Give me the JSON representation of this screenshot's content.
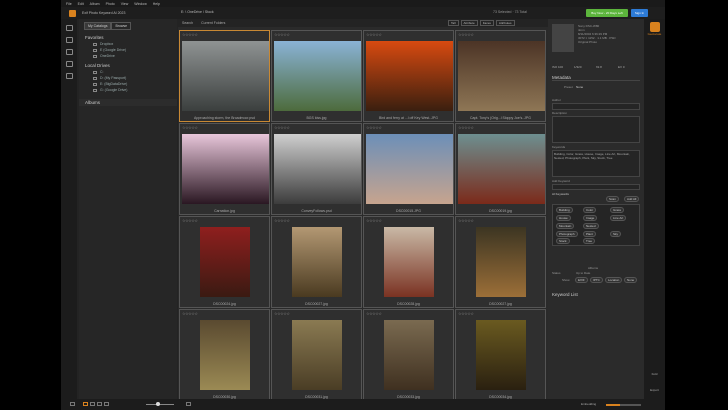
{
  "menu": [
    "File",
    "Edit",
    "Album",
    "Photo",
    "View",
    "Window",
    "Help"
  ],
  "window": {
    "title": "Exif Photo Keyword AI 2023"
  },
  "breadcrumb": "E: \\ OneDrive \\ Stock",
  "selection": "73 Selected · 73 Total",
  "buy_label": "Buy Now - 20 Days Left",
  "signin_label": "Sign In",
  "geolocate": "Geolocate",
  "nav": {
    "tabs": [
      "My Catalogs",
      "Browse"
    ],
    "favorites_head": "Favorites",
    "favorites": [
      "Dropbox",
      "E (Google Drive)",
      "OneDrive"
    ],
    "local_head": "Local Drives",
    "local": [
      "C:",
      "D: (My Passport)",
      "E: (BigDataDrive)",
      "G: (Google Drive)"
    ],
    "albums_head": "Albums"
  },
  "grid": {
    "search_label": "Search",
    "folder_label": "Current Folders",
    "filters": [
      "Tall",
      "Attribute",
      "Faces",
      "Attributes"
    ],
    "sort_label": "Name",
    "rating": "☆☆☆☆☆",
    "items": [
      {
        "name": "Approaching storm, the Broadmoor.psd",
        "selected": true,
        "colors": [
          "#8f9393",
          "#3b3f3e"
        ]
      },
      {
        "name": "BGS kiss.jpg",
        "selected": false,
        "colors": [
          "#8ab3d6",
          "#4d6b3c"
        ]
      },
      {
        "name": "Bird and ferry at ...l off Key West..JPG",
        "selected": false,
        "colors": [
          "#d84a10",
          "#3a1f0f"
        ]
      },
      {
        "name": "Capt. Tony's (Orig...l Sloppy Joe's..JPG",
        "selected": false,
        "colors": [
          "#4c3426",
          "#8e7655"
        ]
      },
      {
        "name": "Carnation.jpg",
        "selected": false,
        "colors": [
          "#e8c6da",
          "#2a1722"
        ]
      },
      {
        "name": "ConveyFollows.psd",
        "selected": false,
        "colors": [
          "#cfcfcf",
          "#3c3c3c"
        ]
      },
      {
        "name": "DSC00015.JPG",
        "selected": false,
        "colors": [
          "#6c8fb8",
          "#c7a48e"
        ]
      },
      {
        "name": "DSC00019.jpg",
        "selected": false,
        "colors": [
          "#6d8f90",
          "#7b2a1a"
        ]
      },
      {
        "name": "DSC00024.jpg",
        "selected": false,
        "colors": [
          "#8f1f1e",
          "#3a1a12"
        ]
      },
      {
        "name": "DSC00027.jpg",
        "selected": false,
        "colors": [
          "#b39873",
          "#4a3a20"
        ]
      },
      {
        "name": "DSC00028.jpg",
        "selected": false,
        "colors": [
          "#c9b9a6",
          "#7a3222"
        ]
      },
      {
        "name": "DSC00027.jpg",
        "selected": false,
        "colors": [
          "#3c3522",
          "#9c6f38"
        ]
      },
      {
        "name": "DSC00030.jpg",
        "selected": false,
        "colors": [
          "#5a4a30",
          "#9b8a54"
        ]
      },
      {
        "name": "DSC00031.jpg",
        "selected": false,
        "colors": [
          "#8a7a52",
          "#4a3d25"
        ]
      },
      {
        "name": "DSC00033.jpg",
        "selected": false,
        "colors": [
          "#7a6a50",
          "#3f3020"
        ]
      },
      {
        "name": "DSC00034.jpg",
        "selected": false,
        "colors": [
          "#6a5a20",
          "#2a2010"
        ]
      }
    ]
  },
  "info": {
    "line1": "Sony DSC-W80",
    "line2": "4mm",
    "line3": "8/11/2002 6:36:29 PM",
    "line4": "3072 × 1152 · 1.1 MB · PSD",
    "line5": "Original Photo",
    "exif": [
      "ISO 100",
      "1/320",
      "f/2.8",
      "EV 0"
    ],
    "metadata_head": "Metadata",
    "preset_label": "Preset",
    "preset_value": "None",
    "author_label": "Author",
    "description_label": "Description",
    "keywords_label": "Keywords",
    "keywords_text": "Building, Color, Grass, House, Image, Line Art, Mountain, Nested, Photograph, Plant, Sky, Stock, Tree",
    "add_keyword_label": "Add Keyword",
    "ai_keywords_label": "AI Keywords",
    "scan_label": "Scan",
    "add_all_label": "Add All",
    "ai_pills": [
      "Building",
      "Color",
      "Grass",
      "House",
      "Image",
      "Line Art",
      "Mountain",
      "Nested",
      "Photograph",
      "Plant",
      "Sky",
      "Stock",
      "Tree"
    ],
    "albums_label": "Albums",
    "status_label": "Status",
    "status_value": "Up to Date",
    "show_label": "Show",
    "show_options": [
      "EXIF",
      "IPTC",
      "Location",
      "None"
    ],
    "keyword_list_label": "Keyword List"
  },
  "farright": {
    "fold_label": "Fold",
    "export_label": "Export"
  },
  "status": {
    "embedding_label": "Embedding",
    "progress": 0.4
  }
}
